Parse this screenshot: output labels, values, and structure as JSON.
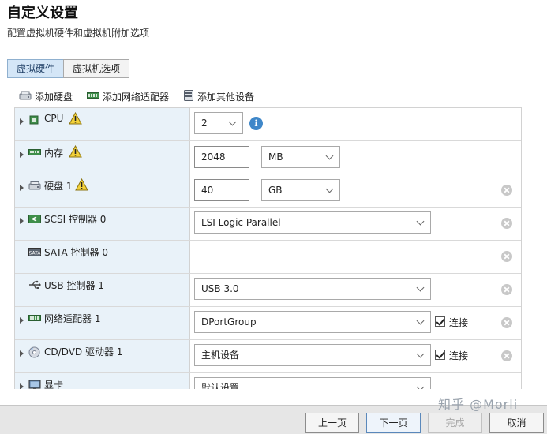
{
  "header": {
    "title": "自定义设置",
    "subtitle": "配置虚拟机硬件和虚拟机附加选项"
  },
  "tabs": [
    {
      "label": "虚拟硬件",
      "active": true
    },
    {
      "label": "虚拟机选项",
      "active": false
    }
  ],
  "toolbar": {
    "add_disk": "添加硬盘",
    "add_network": "添加网络适配器",
    "add_other": "添加其他设备"
  },
  "devices": {
    "cpu": {
      "label": "CPU",
      "value": "2",
      "icon": "cpu-icon",
      "warning": true
    },
    "memory": {
      "label": "内存",
      "value": "2048",
      "unit": "MB",
      "icon": "memory-icon",
      "warning": true
    },
    "disk": {
      "label": "硬盘 1",
      "value": "40",
      "unit": "GB",
      "icon": "hard-disk-icon",
      "warning": true
    },
    "scsi": {
      "label": "SCSI 控制器 0",
      "value": "LSI Logic Parallel",
      "icon": "scsi-icon"
    },
    "sata": {
      "label": "SATA 控制器 0",
      "icon": "sata-icon"
    },
    "usb": {
      "label": "USB 控制器 1",
      "value": "USB 3.0",
      "icon": "usb-icon"
    },
    "network": {
      "label": "网络适配器 1",
      "value": "DPortGroup",
      "connect_label": "连接",
      "connected": true,
      "icon": "network-adapter-icon"
    },
    "cdrom": {
      "label": "CD/DVD 驱动器 1",
      "value": "主机设备",
      "connect_label": "连接",
      "connected": true,
      "icon": "cd-dvd-icon"
    },
    "video": {
      "label": "显卡",
      "value": "默认设置",
      "icon": "display-icon"
    }
  },
  "footer": {
    "back": "上一页",
    "next": "下一页",
    "finish": "完成",
    "cancel": "取消"
  },
  "watermark": "知乎 @Morli",
  "colors": {
    "left_column_bg": "#e9f2f9",
    "active_tab_bg": "#d4e6f7",
    "info_blue": "#3f87c9",
    "warning_yellow": "#f3d13a"
  }
}
